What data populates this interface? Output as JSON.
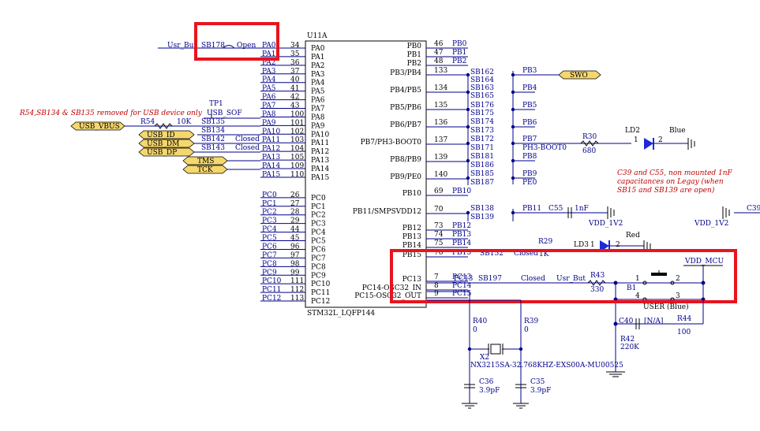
{
  "chip": {
    "ref": "U11A",
    "part": "STM32L_LQFP144",
    "left_pins": [
      {
        "num": "34",
        "name": "PA0",
        "net": "PA0"
      },
      {
        "num": "35",
        "name": "PA1",
        "net": "PA1"
      },
      {
        "num": "36",
        "name": "PA2",
        "net": "PA2"
      },
      {
        "num": "37",
        "name": "PA3",
        "net": "PA3"
      },
      {
        "num": "40",
        "name": "PA4",
        "net": "PA4"
      },
      {
        "num": "41",
        "name": "PA5",
        "net": "PA5"
      },
      {
        "num": "42",
        "name": "PA6",
        "net": "PA6"
      },
      {
        "num": "43",
        "name": "PA7",
        "net": "PA7"
      },
      {
        "num": "100",
        "name": "PA8",
        "net": "PA8"
      },
      {
        "num": "101",
        "name": "PA9",
        "net": "PA9"
      },
      {
        "num": "102",
        "name": "PA10",
        "net": "PA10"
      },
      {
        "num": "103",
        "name": "PA11",
        "net": "PA11"
      },
      {
        "num": "104",
        "name": "PA12",
        "net": "PA12"
      },
      {
        "num": "105",
        "name": "PA13",
        "net": "PA13"
      },
      {
        "num": "109",
        "name": "PA14",
        "net": "PA14"
      },
      {
        "num": "110",
        "name": "PA15",
        "net": "PA15"
      },
      {
        "num": "26",
        "name": "PC0",
        "net": "PC0"
      },
      {
        "num": "27",
        "name": "PC1",
        "net": "PC1"
      },
      {
        "num": "28",
        "name": "PC2",
        "net": "PC2"
      },
      {
        "num": "29",
        "name": "PC3",
        "net": "PC3"
      },
      {
        "num": "44",
        "name": "PC4",
        "net": "PC4"
      },
      {
        "num": "45",
        "name": "PC5",
        "net": "PC5"
      },
      {
        "num": "96",
        "name": "PC6",
        "net": "PC6"
      },
      {
        "num": "97",
        "name": "PC7",
        "net": "PC7"
      },
      {
        "num": "98",
        "name": "PC8",
        "net": "PC8"
      },
      {
        "num": "99",
        "name": "PC9",
        "net": "PC9"
      },
      {
        "num": "111",
        "name": "PC10",
        "net": "PC10"
      },
      {
        "num": "112",
        "name": "PC11",
        "net": "PC11"
      },
      {
        "num": "113",
        "name": "PC12",
        "net": "PC12"
      }
    ],
    "right_pins": [
      {
        "num": "46",
        "name": "PB0",
        "net": "PB0"
      },
      {
        "num": "47",
        "name": "PB1",
        "net": "PB1"
      },
      {
        "num": "48",
        "name": "PB2",
        "net": "PB2"
      },
      {
        "num": "133",
        "name": "PB3/PB4",
        "net": ""
      },
      {
        "num": "134",
        "name": "PB4/PB5",
        "net": ""
      },
      {
        "num": "135",
        "name": "PB5/PB6",
        "net": ""
      },
      {
        "num": "136",
        "name": "PB6/PB7",
        "net": ""
      },
      {
        "num": "137",
        "name": "PB7/PH3-BOOT0",
        "net": ""
      },
      {
        "num": "139",
        "name": "PB8/PB9",
        "net": ""
      },
      {
        "num": "140",
        "name": "PB9/PE0",
        "net": ""
      },
      {
        "num": "69",
        "name": "PB10",
        "net": "PB10"
      },
      {
        "num": "70",
        "name": "PB11/SMPSVDD12",
        "net": ""
      },
      {
        "num": "73",
        "name": "PB12",
        "net": "PB12"
      },
      {
        "num": "74",
        "name": "PB13",
        "net": "PB13"
      },
      {
        "num": "75",
        "name": "PB14",
        "net": "PB14"
      },
      {
        "num": "76",
        "name": "PB15",
        "net": "PB15"
      },
      {
        "num": "7",
        "name": "PC13",
        "net": "PC13"
      },
      {
        "num": "8",
        "name": "PC14-OSC32_IN",
        "net": "PC14"
      },
      {
        "num": "9",
        "name": "PC15-OSC32_OUT",
        "net": "PC15"
      }
    ]
  },
  "jumpers": {
    "sb178": "SB178",
    "sb178_state": "Open",
    "usr_but_top": "Usr_But",
    "sb162": "SB162",
    "sb164": "SB164",
    "sb163": "SB163",
    "sb165": "SB165",
    "sb176": "SB176",
    "sb175": "SB175",
    "sb174": "SB174",
    "sb173": "SB173",
    "sb172": "SB172",
    "sb171": "SB171",
    "sb181": "SB181",
    "sb186": "SB186",
    "sb185": "SB185",
    "sb187": "SB187",
    "sb138": "SB138",
    "sb139": "SB139",
    "sb135": "SB135",
    "sb134": "SB134",
    "sb142": "SB142",
    "sb143": "SB143",
    "closed": "Closed",
    "sb152": "SB152",
    "sb197": "SB197"
  },
  "nets": {
    "pb3": "PB3",
    "pb4": "PB4",
    "pb5": "PB5",
    "pb6": "PB6",
    "pb7": "PB7",
    "ph3boot": "PH3-BOOT0",
    "pb8": "PB8",
    "pb9": "PB9",
    "pe0": "PE0",
    "pb11": "PB11",
    "swo": "SWO",
    "usb_vbus": "USB_VBUS",
    "usb_id": "USB_ID",
    "usb_dm": "USB_DM",
    "usb_dp": "USB_DP",
    "tms": "TMS",
    "tck": "TCK",
    "usb_sof": "USB_SOF",
    "tp1": "TP1",
    "vdd_1v2": "VDD_1V2",
    "vdd_mcu": "VDD_MCU",
    "usr_but": "Usr_But",
    "pc13": "PC13"
  },
  "parts": {
    "r54": "R54",
    "r54v": "10K",
    "r30": "R30",
    "r30v": "680",
    "ld2": "LD2",
    "ld2c": "Blue",
    "ld3": "LD3",
    "ld3c": "Red",
    "r29": "R29",
    "r29v": "1K",
    "c55": "C55",
    "c55v": "1nF",
    "c39": "C39",
    "r43": "R43",
    "r43v": "330",
    "b1": "B1",
    "user_btn": "USER (Blue)",
    "r40": "R40",
    "r40v": "0",
    "r39": "R39",
    "r39v": "0",
    "x2": "X2",
    "x2part": "NX3215SA-32.768KHZ-EXS00A-MU00525",
    "c36": "C36",
    "c36v": "3.9pF",
    "c35": "C35",
    "c35v": "3.9pF",
    "c40": "C40",
    "c40v": "[N/A]",
    "r42": "R42",
    "r42v": "220K",
    "r44": "R44",
    "r44v": "100",
    "one": "1",
    "two": "2",
    "three": "3",
    "four": "4"
  },
  "notes": {
    "usb_note": "R54,SB134 & SB135 removed for USB device only",
    "cap_note1": "C39 and C55, non mounted 1nF",
    "cap_note2": "capacitances on Legay (when",
    "cap_note3": "SB15 and SB139 are open)"
  },
  "colors": {
    "highlight": "#e8141e",
    "wire": "#00008b",
    "note": "#c00000"
  }
}
